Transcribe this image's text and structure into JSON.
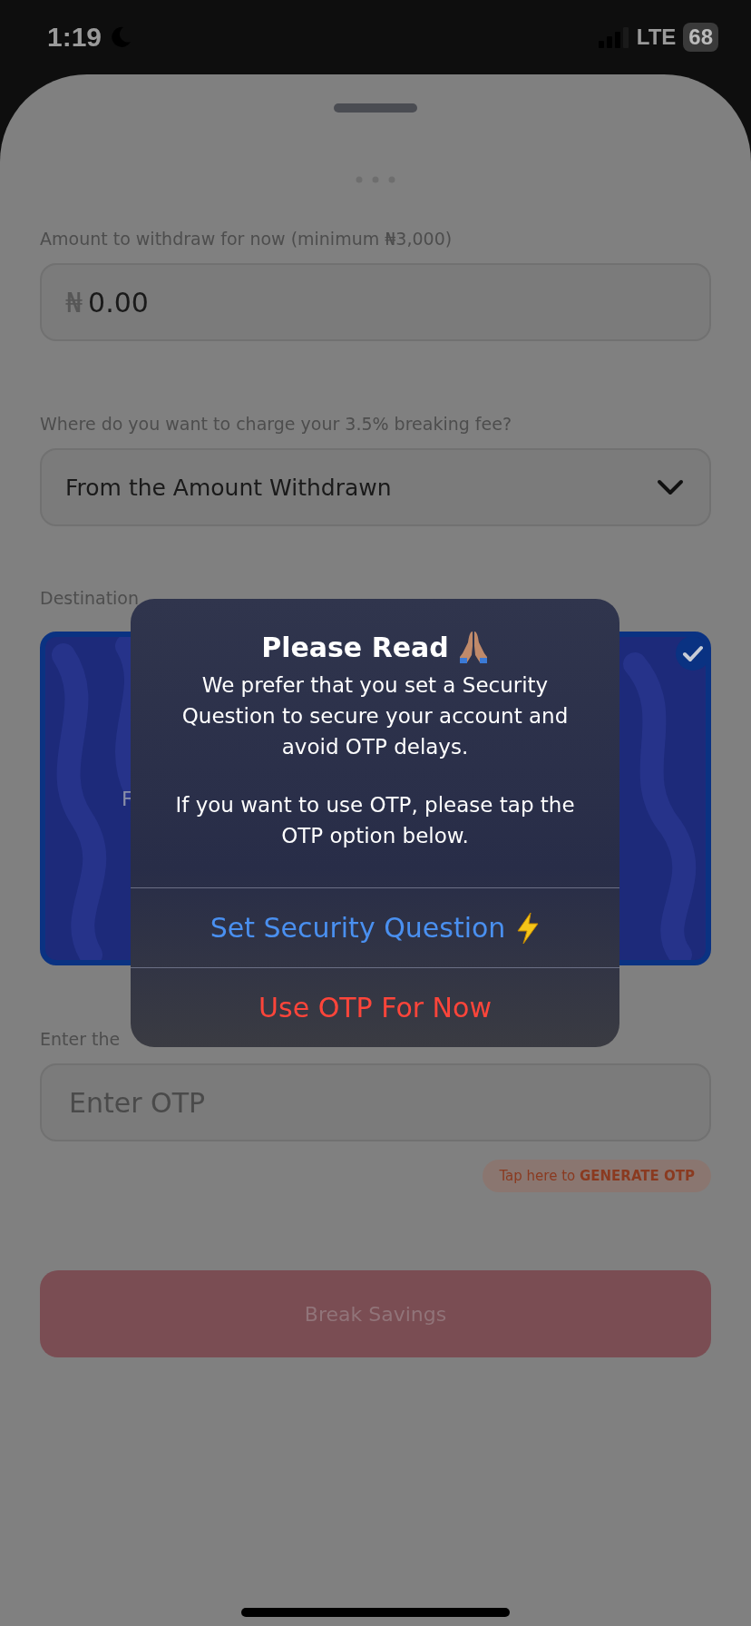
{
  "status_bar": {
    "time": "1:19",
    "network": "LTE",
    "battery": "68"
  },
  "form": {
    "amount_label": "Amount to withdraw for now (minimum ₦3,000)",
    "amount_input": {
      "currency": "₦",
      "value": "0.00"
    },
    "fee_label": "Where do you want to charge your 3.5% breaking fee?",
    "fee_select": {
      "value": "From the Amount Withdrawn"
    },
    "destination_label": "Destination",
    "destination_card": {
      "selected": true,
      "text": "F"
    },
    "otp_label": "Enter the",
    "otp_input": {
      "placeholder": "Enter OTP"
    },
    "generate_otp_link": "Tap here to **GENERATE OTP**",
    "submit_button": {
      "label": "Break Savings",
      "disabled": true
    }
  },
  "dialog": {
    "title": "Please Read",
    "messages": [
      "We prefer that you set a Security Question to secure your account and avoid OTP delays.",
      "If you want to use OTP, please tap the OTP option below."
    ],
    "actions": [
      {
        "label": "Set Security Question",
        "kind": "default"
      },
      {
        "label": "Use OTP For Now",
        "kind": "destructive"
      }
    ]
  }
}
